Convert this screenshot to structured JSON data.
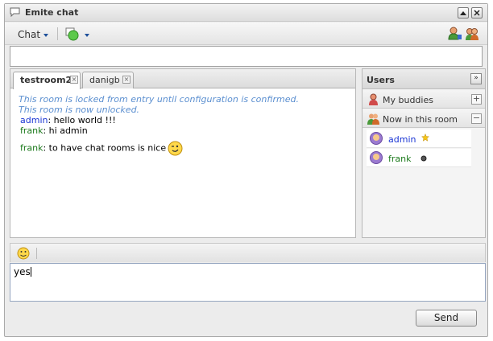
{
  "window": {
    "title": "Emite chat"
  },
  "toolbar": {
    "chat_menu_label": "Chat"
  },
  "room": {
    "tabs": [
      {
        "label": "testroom2",
        "active": true
      },
      {
        "label": "danigb",
        "active": false
      }
    ],
    "messages": {
      "info1": "This room is locked from entry until configuration is confirmed.",
      "info2": "This room is now unlocked.",
      "m1_nick": "admin",
      "m1_text": ": hello world !!!",
      "m2_nick": "frank",
      "m2_text": ": hi admin",
      "m3_nick": "frank",
      "m3_text": ": to have chat rooms is nice"
    }
  },
  "users": {
    "title": "Users",
    "groups": [
      {
        "label": "My buddies",
        "button": "+"
      },
      {
        "label": "Now in this room",
        "button": "−"
      }
    ],
    "list": [
      {
        "name": "admin",
        "color": "#1a35d4",
        "badge": "star-icon"
      },
      {
        "name": "frank",
        "color": "#1c7a1c",
        "badge": "presence-dot-icon"
      }
    ]
  },
  "compose": {
    "value": "yes"
  },
  "send": {
    "label": "Send"
  },
  "colors": {
    "info_text": "#5b8fd0",
    "admin": "#1a35d4",
    "frank": "#1c7a1c"
  }
}
